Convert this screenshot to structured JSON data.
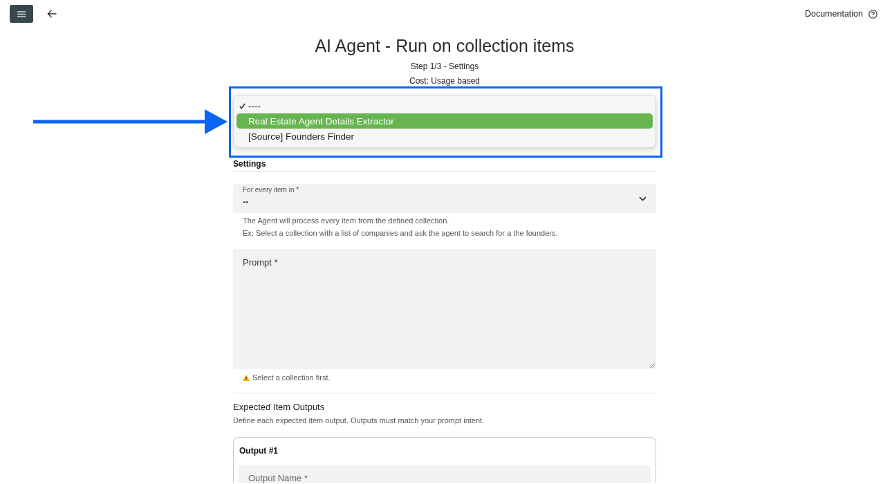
{
  "top_bar": {
    "documentation_link": "Documentation"
  },
  "header": {
    "title": "AI Agent - Run on collection items",
    "step": "Step 1/3 - Settings",
    "cost": "Cost: Usage based"
  },
  "annotations": {
    "frame": true,
    "arrow": true
  },
  "agent_dropdown": {
    "options": [
      {
        "label": "----",
        "checked": true,
        "selected": false
      },
      {
        "label": "Real Estate Agent Details Extractor",
        "checked": false,
        "selected": true
      },
      {
        "label": "[Source] Founders Finder",
        "checked": false,
        "selected": false
      }
    ]
  },
  "settings": {
    "heading": "Settings",
    "collection_field": {
      "label": "For every item in *",
      "value": "--"
    },
    "collection_help": [
      "The Agent will process every item from the defined collection.",
      "Ex: Select a collection with a list of companies and ask the agent to search for a the founders."
    ],
    "prompt_field": {
      "label": "Prompt *"
    },
    "prompt_warning": "Select a collection first."
  },
  "outputs": {
    "heading": "Expected Item Outputs",
    "description": "Define each expected item output. Outputs must match your prompt intent.",
    "items": [
      {
        "title": "Output #1",
        "name_field": {
          "label": "Output Name *"
        }
      }
    ]
  }
}
